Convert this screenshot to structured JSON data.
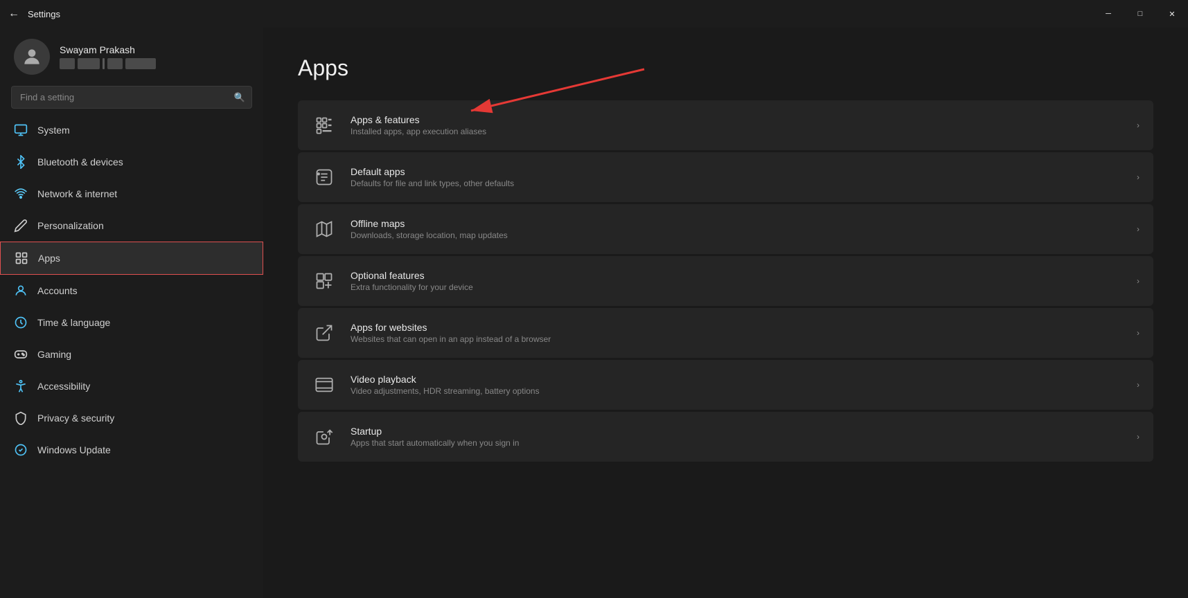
{
  "titleBar": {
    "title": "Settings",
    "minimize": "─",
    "maximize": "□",
    "close": "✕"
  },
  "user": {
    "name": "Swayam Prakash"
  },
  "search": {
    "placeholder": "Find a setting"
  },
  "nav": {
    "items": [
      {
        "id": "system",
        "label": "System",
        "iconType": "system"
      },
      {
        "id": "bluetooth",
        "label": "Bluetooth & devices",
        "iconType": "bluetooth"
      },
      {
        "id": "network",
        "label": "Network & internet",
        "iconType": "network"
      },
      {
        "id": "personalization",
        "label": "Personalization",
        "iconType": "personalization"
      },
      {
        "id": "apps",
        "label": "Apps",
        "iconType": "apps",
        "active": true
      },
      {
        "id": "accounts",
        "label": "Accounts",
        "iconType": "accounts"
      },
      {
        "id": "time",
        "label": "Time & language",
        "iconType": "time"
      },
      {
        "id": "gaming",
        "label": "Gaming",
        "iconType": "gaming"
      },
      {
        "id": "accessibility",
        "label": "Accessibility",
        "iconType": "accessibility"
      },
      {
        "id": "privacy",
        "label": "Privacy & security",
        "iconType": "privacy"
      },
      {
        "id": "update",
        "label": "Windows Update",
        "iconType": "update"
      }
    ]
  },
  "content": {
    "pageTitle": "Apps",
    "items": [
      {
        "id": "apps-features",
        "title": "Apps & features",
        "description": "Installed apps, app execution aliases",
        "iconType": "apps-features"
      },
      {
        "id": "default-apps",
        "title": "Default apps",
        "description": "Defaults for file and link types, other defaults",
        "iconType": "default-apps"
      },
      {
        "id": "offline-maps",
        "title": "Offline maps",
        "description": "Downloads, storage location, map updates",
        "iconType": "offline-maps"
      },
      {
        "id": "optional-features",
        "title": "Optional features",
        "description": "Extra functionality for your device",
        "iconType": "optional-features"
      },
      {
        "id": "apps-websites",
        "title": "Apps for websites",
        "description": "Websites that can open in an app instead of a browser",
        "iconType": "apps-websites"
      },
      {
        "id": "video-playback",
        "title": "Video playback",
        "description": "Video adjustments, HDR streaming, battery options",
        "iconType": "video-playback"
      },
      {
        "id": "startup",
        "title": "Startup",
        "description": "Apps that start automatically when you sign in",
        "iconType": "startup"
      }
    ]
  }
}
